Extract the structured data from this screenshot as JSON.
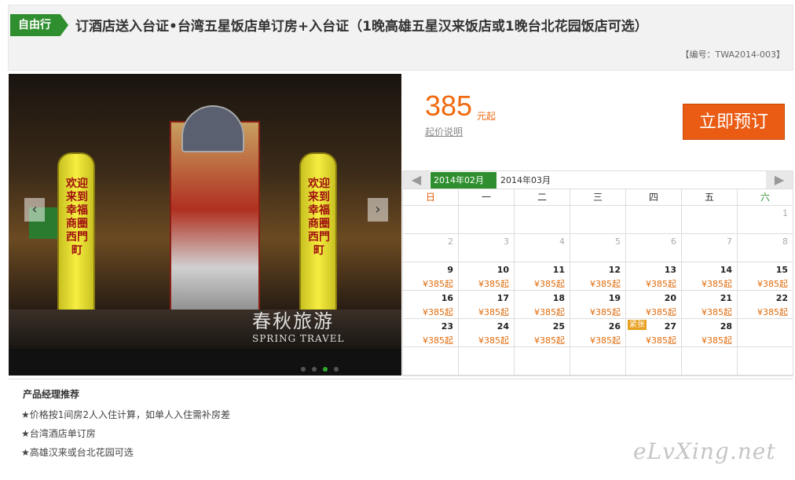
{
  "header": {
    "tag": "自由行",
    "title": "订酒店送入台证•台湾五星饭店单订房+入台证（1晚高雄五星汉来饭店或1晚台北花园饭店可选）",
    "code": "【编号：TWA2014-003】"
  },
  "photo": {
    "pillar_text_left": "欢迎来到幸福商圈 西門町",
    "pillar_text_right": "欢迎来到幸福商圈 西門町",
    "watermark_cn": "春秋旅游",
    "watermark_en": "SPRING TRAVEL",
    "prev_arrow": "‹",
    "next_arrow": "›",
    "slide_count": 4,
    "active_slide": 3
  },
  "price": {
    "amount": "385",
    "unit": "元起",
    "note": "起价说明",
    "book_label": "立即预订"
  },
  "calendar": {
    "prev_label": "◀",
    "next_label": "▶",
    "months": [
      "2014年02月",
      "2014年03月"
    ],
    "active_month": "2014年02月",
    "weekdays": [
      "日",
      "一",
      "二",
      "三",
      "四",
      "五",
      "六"
    ],
    "weeks": [
      [
        {
          "d": ""
        },
        {
          "d": ""
        },
        {
          "d": ""
        },
        {
          "d": ""
        },
        {
          "d": ""
        },
        {
          "d": ""
        },
        {
          "d": "1",
          "dim": true
        }
      ],
      [
        {
          "d": "2",
          "dim": true
        },
        {
          "d": "3",
          "dim": true
        },
        {
          "d": "4",
          "dim": true
        },
        {
          "d": "5",
          "dim": true
        },
        {
          "d": "6",
          "dim": true
        },
        {
          "d": "7",
          "dim": true
        },
        {
          "d": "8",
          "dim": true
        }
      ],
      [
        {
          "d": "9",
          "p": "¥385起"
        },
        {
          "d": "10",
          "p": "¥385起"
        },
        {
          "d": "11",
          "p": "¥385起"
        },
        {
          "d": "12",
          "p": "¥385起"
        },
        {
          "d": "13",
          "p": "¥385起"
        },
        {
          "d": "14",
          "p": "¥385起"
        },
        {
          "d": "15",
          "p": "¥385起"
        }
      ],
      [
        {
          "d": "16",
          "p": "¥385起"
        },
        {
          "d": "17",
          "p": "¥385起"
        },
        {
          "d": "18",
          "p": "¥385起"
        },
        {
          "d": "19",
          "p": "¥385起"
        },
        {
          "d": "20",
          "p": "¥385起"
        },
        {
          "d": "21",
          "p": "¥385起"
        },
        {
          "d": "22",
          "p": "¥385起"
        }
      ],
      [
        {
          "d": "23",
          "p": "¥385起"
        },
        {
          "d": "24",
          "p": "¥385起"
        },
        {
          "d": "25",
          "p": "¥385起"
        },
        {
          "d": "26",
          "p": "¥385起"
        },
        {
          "d": "27",
          "p": "¥385起",
          "badge": "紧张"
        },
        {
          "d": "28",
          "p": "¥385起"
        },
        {
          "d": ""
        }
      ],
      [
        {
          "d": ""
        },
        {
          "d": ""
        },
        {
          "d": ""
        },
        {
          "d": ""
        },
        {
          "d": ""
        },
        {
          "d": ""
        },
        {
          "d": ""
        }
      ]
    ]
  },
  "recommend": {
    "title": "产品经理推荐",
    "items": [
      "★价格按1间房2人入住计算，如单人入住需补房差",
      "★台湾酒店单订房",
      "★高雄汉来或台北花园可选"
    ]
  },
  "site_watermark": "eLvXing.net",
  "colors": {
    "brand_green": "#2f8f2f",
    "price_orange": "#f06a0f",
    "button_orange": "#ea5c14"
  }
}
